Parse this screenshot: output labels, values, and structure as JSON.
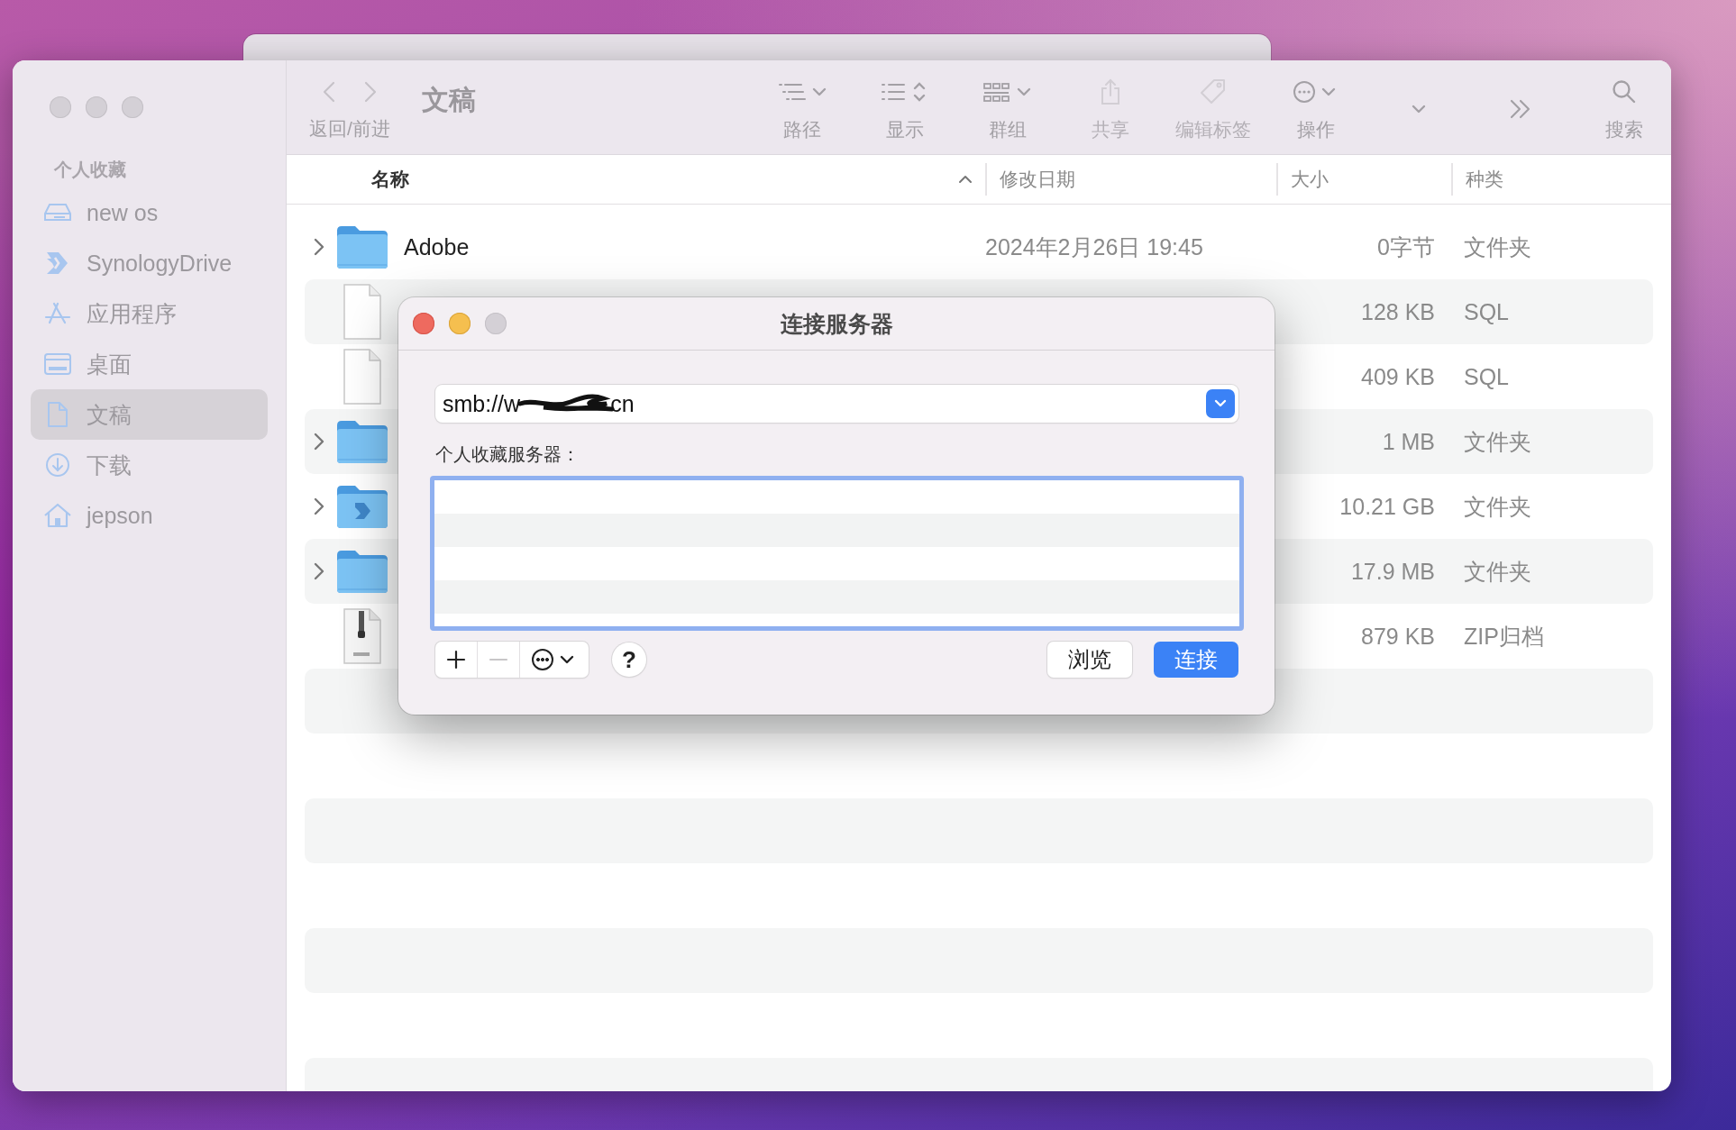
{
  "finder": {
    "sidebar": {
      "section": "个人收藏",
      "items": [
        {
          "kind": "drive",
          "label": "new os",
          "selected": false
        },
        {
          "kind": "synology",
          "label": "SynologyDrive",
          "selected": false
        },
        {
          "kind": "apps",
          "label": "应用程序",
          "selected": false
        },
        {
          "kind": "desktop",
          "label": "桌面",
          "selected": false
        },
        {
          "kind": "doc",
          "label": "文稿",
          "selected": true
        },
        {
          "kind": "download",
          "label": "下载",
          "selected": false
        },
        {
          "kind": "home",
          "label": "jepson",
          "selected": false
        }
      ]
    },
    "toolbar": {
      "nav_label": "返回/前进",
      "title": "文稿",
      "items": [
        {
          "kind": "path",
          "label": "路径",
          "disabled": false
        },
        {
          "kind": "view",
          "label": "显示",
          "disabled": false
        },
        {
          "kind": "group",
          "label": "群组",
          "disabled": false
        },
        {
          "kind": "share",
          "label": "共享",
          "disabled": true
        },
        {
          "kind": "tag",
          "label": "编辑标签",
          "disabled": true
        },
        {
          "kind": "action",
          "label": "操作",
          "disabled": false
        },
        {
          "kind": "dropdown",
          "disabled": false
        },
        {
          "kind": "more",
          "disabled": false
        },
        {
          "kind": "search",
          "label": "搜索",
          "disabled": false
        }
      ]
    },
    "table": {
      "columns": [
        {
          "label": "名称",
          "sorted": true
        },
        {
          "label": "修改日期",
          "sorted": false
        },
        {
          "label": "大小",
          "sorted": false
        },
        {
          "label": "种类",
          "sorted": false
        }
      ],
      "rows": [
        {
          "kind": "folder",
          "expandable": true,
          "name": "Adobe",
          "date": "2024年2月26日 19:45",
          "size": "0字节",
          "type_label": "文件夹"
        },
        {
          "kind": "document",
          "expandable": false,
          "size": "128 KB",
          "type_label": "SQL"
        },
        {
          "kind": "document",
          "expandable": false,
          "size": "409 KB",
          "type_label": "SQL"
        },
        {
          "kind": "folder",
          "expandable": true,
          "size": "1 MB",
          "type_label": "文件夹"
        },
        {
          "kind": "synology-folder",
          "expandable": true,
          "size": "10.21 GB",
          "type_label": "文件夹"
        },
        {
          "kind": "folder",
          "expandable": true,
          "size": "17.9 MB",
          "type_label": "文件夹"
        },
        {
          "kind": "zip",
          "expandable": false,
          "size": "879 KB",
          "type_label": "ZIP归档"
        }
      ]
    }
  },
  "dialog": {
    "title": "连接服务器",
    "url_start": "smb://w",
    "url_end": "cn",
    "favorites_label": "个人收藏服务器：",
    "tools": [
      {
        "kind": "plus",
        "disabled": false
      },
      {
        "kind": "minus",
        "disabled": true
      },
      {
        "kind": "action",
        "disabled": false
      }
    ],
    "help": "?",
    "buttons": [
      {
        "label": "浏览",
        "primary": false
      },
      {
        "label": "连接",
        "primary": true
      }
    ]
  }
}
